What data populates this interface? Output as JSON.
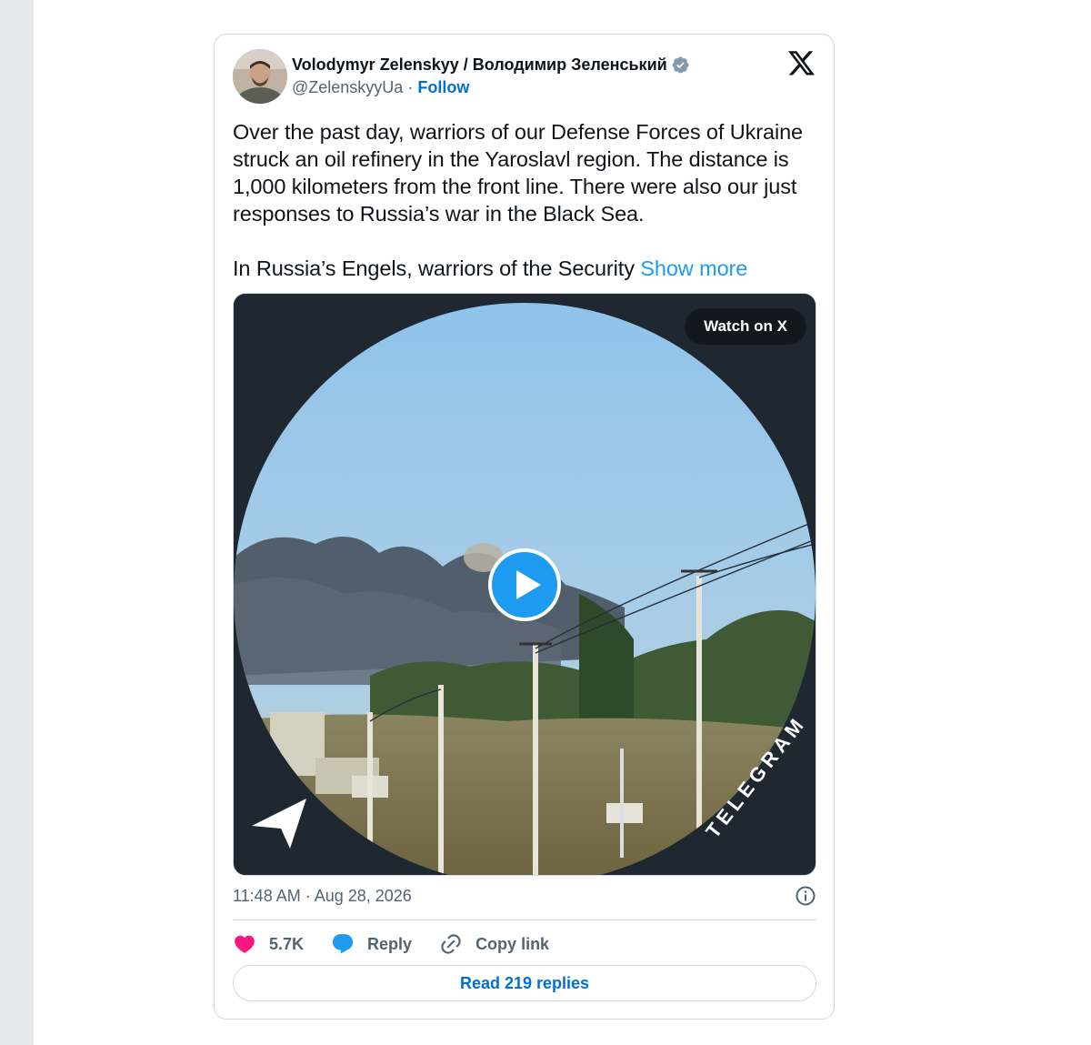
{
  "author": {
    "display_name": "Volodymyr Zelenskyy / Володимир Зеленський",
    "handle": "@ZelenskyyUa",
    "separator": "·",
    "follow_label": "Follow",
    "verified_icon": "verified-badge-icon"
  },
  "tweet": {
    "paragraph_1": "Over the past day, warriors of our Defense Forces of Ukraine struck an oil refinery in the Yaroslavl region. The distance is 1,000 kilometers from the front line. There were also our just responses to Russia’s war in the Black Sea.",
    "paragraph_2": "In Russia’s Engels, warriors of the Security ",
    "show_more_label": "Show more",
    "timestamp": "11:48 AM · Aug 28, 2026"
  },
  "media": {
    "watch_label": "Watch on X",
    "watermark": "TELEGRAM"
  },
  "actions": {
    "likes_count": "5.7K",
    "reply_label": "Reply",
    "copy_link_label": "Copy link",
    "read_replies_label": "Read 219 replies"
  },
  "colors": {
    "link": "#006fd6",
    "accent_blue": "#1d9bf0",
    "like_pink": "#f91880",
    "muted_text": "#536471",
    "border": "#cfd9de"
  }
}
